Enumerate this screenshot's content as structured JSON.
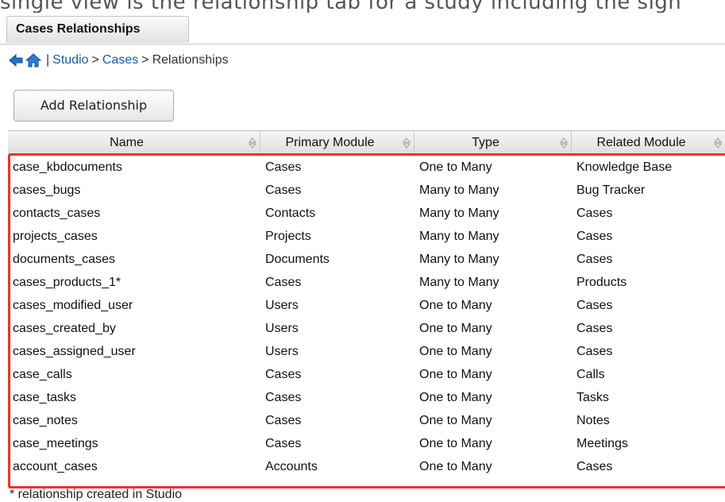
{
  "top_text": "single view is the relationship tab for a study including the sign",
  "tab": {
    "label": "Cases Relationships"
  },
  "breadcrumb": {
    "studio": "Studio",
    "cases": "Cases",
    "current": "Relationships",
    "separator": ">",
    "pipe": "|"
  },
  "toolbar": {
    "add_label": "Add Relationship"
  },
  "table": {
    "headers": [
      "Name",
      "Primary Module",
      "Type",
      "Related Module"
    ],
    "rows": [
      [
        "case_kbdocuments",
        "Cases",
        "One to Many",
        "Knowledge Base"
      ],
      [
        "cases_bugs",
        "Cases",
        "Many to Many",
        "Bug Tracker"
      ],
      [
        "contacts_cases",
        "Contacts",
        "Many to Many",
        "Cases"
      ],
      [
        "projects_cases",
        "Projects",
        "Many to Many",
        "Cases"
      ],
      [
        "documents_cases",
        "Documents",
        "Many to Many",
        "Cases"
      ],
      [
        "cases_products_1*",
        "Cases",
        "Many to Many",
        "Products"
      ],
      [
        "cases_modified_user",
        "Users",
        "One to Many",
        "Cases"
      ],
      [
        "cases_created_by",
        "Users",
        "One to Many",
        "Cases"
      ],
      [
        "cases_assigned_user",
        "Users",
        "One to Many",
        "Cases"
      ],
      [
        "case_calls",
        "Cases",
        "One to Many",
        "Calls"
      ],
      [
        "case_tasks",
        "Cases",
        "One to Many",
        "Tasks"
      ],
      [
        "case_notes",
        "Cases",
        "One to Many",
        "Notes"
      ],
      [
        "case_meetings",
        "Cases",
        "One to Many",
        "Meetings"
      ],
      [
        "account_cases",
        "Accounts",
        "One to Many",
        "Cases"
      ]
    ]
  },
  "footnote": "* relationship created in Studio",
  "colors": {
    "link": "#1a5e9e",
    "highlight": "#e8352b",
    "back_arrow": "#1f6fd1"
  }
}
